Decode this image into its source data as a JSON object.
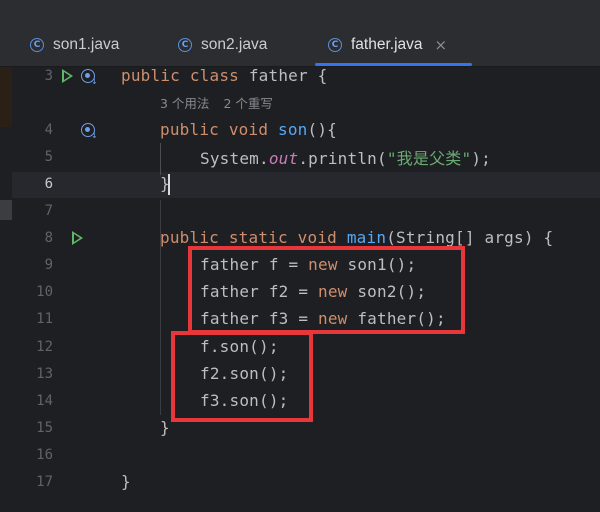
{
  "tabs": [
    {
      "label": "son1.java",
      "icon": "java-class-icon",
      "active": false
    },
    {
      "label": "son2.java",
      "icon": "java-class-icon",
      "active": false
    },
    {
      "label": "father.java",
      "icon": "java-class-icon",
      "active": true,
      "close": "×"
    }
  ],
  "inlay_hint": {
    "usages": "3 个用法",
    "overrides": "2 个重写"
  },
  "lines": {
    "n3": "3",
    "n4": "4",
    "n5": "5",
    "n6": "6",
    "n7": "7",
    "n8": "8",
    "n9": "9",
    "n10": "10",
    "n11": "11",
    "n12": "12",
    "n13": "13",
    "n14": "14",
    "n15": "15",
    "n16": "16",
    "n17": "17",
    "l3": {
      "kw": "public class",
      "name": " father {"
    },
    "l4": {
      "kw": "public void",
      "fn": "son",
      "rest": "(){"
    },
    "l5": {
      "a": "System.",
      "field": "out",
      "b": ".println(",
      "str": "\"我是父类\"",
      "c": ");"
    },
    "l6": {
      "text": "}"
    },
    "l8": {
      "kw": "public static void",
      "fn": "main",
      "rest": "(String[] args) {"
    },
    "l9": {
      "a": "father f = ",
      "kw": "new",
      "b": " son1();"
    },
    "l10": {
      "a": "father f2 = ",
      "kw": "new",
      "b": " son2();"
    },
    "l11": {
      "a": "father f3 = ",
      "kw": "new",
      "b": " father();"
    },
    "l12": {
      "text": "f.son();"
    },
    "l13": {
      "text": "f2.son();"
    },
    "l14": {
      "text": "f3.son();"
    },
    "l15": {
      "text": "}"
    },
    "l17": {
      "text": "}"
    }
  },
  "colors": {
    "keyword": "#cf8e6d",
    "method": "#56a8f5",
    "string": "#6aab73",
    "static_field": "#c77dbb",
    "annotation_box": "#e8373b",
    "tab_accent": "#3574f0"
  }
}
